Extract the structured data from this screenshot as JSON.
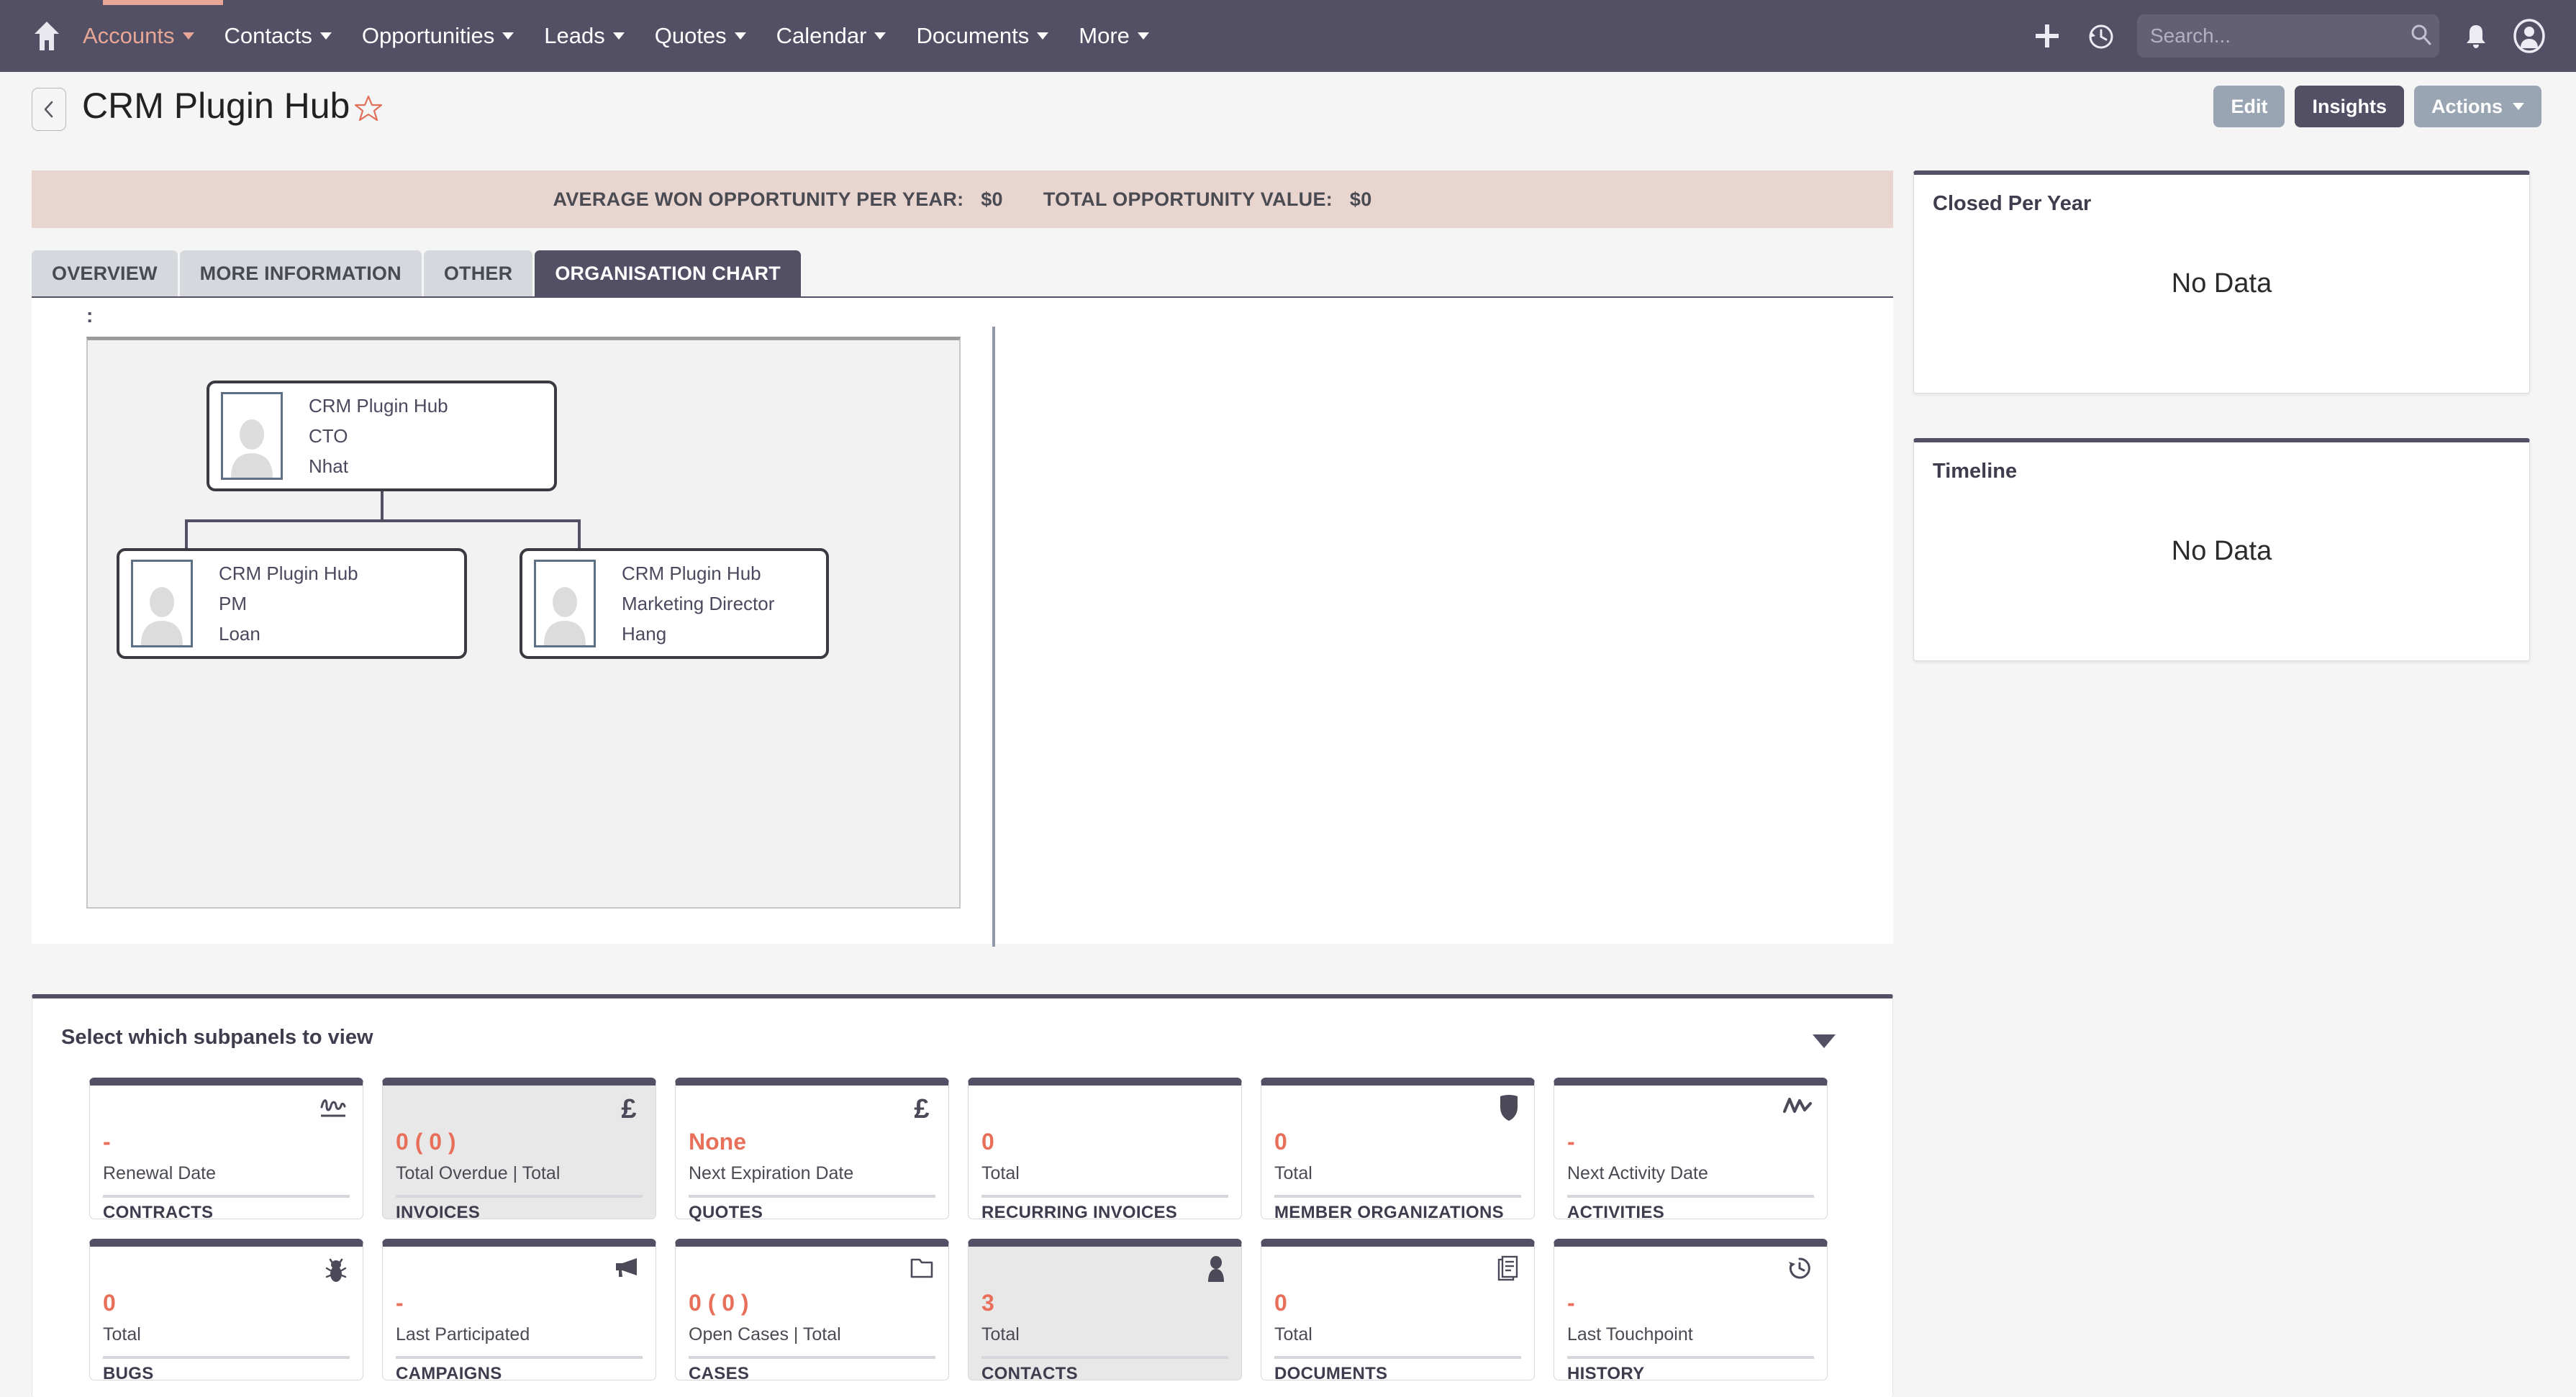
{
  "navbar": {
    "home_icon": "home-icon",
    "items": [
      {
        "label": "Accounts",
        "active": true,
        "caret": true
      },
      {
        "label": "Contacts",
        "active": false,
        "caret": true
      },
      {
        "label": "Opportunities",
        "active": false,
        "caret": true
      },
      {
        "label": "Leads",
        "active": false,
        "caret": true
      },
      {
        "label": "Quotes",
        "active": false,
        "caret": true
      },
      {
        "label": "Calendar",
        "active": false,
        "caret": true
      },
      {
        "label": "Documents",
        "active": false,
        "caret": true
      },
      {
        "label": "More",
        "active": false,
        "caret": true
      }
    ],
    "add_icon": "plus-icon",
    "history_icon": "history-clock-icon",
    "search": {
      "value": "",
      "placeholder": "Search..."
    },
    "search_icon": "search-icon",
    "notifications_icon": "bell-icon",
    "profile_icon": "user-avatar-icon"
  },
  "titlebar": {
    "back_icon": "chevron-left-icon",
    "title": "CRM Plugin Hub",
    "favorite_icon": "star-outline-icon",
    "edit_label": "Edit",
    "insights_label": "Insights",
    "actions_label": "Actions"
  },
  "banner": {
    "avg_label": "AVERAGE WON OPPORTUNITY PER YEAR:",
    "avg_value": "$0",
    "total_label": "TOTAL OPPORTUNITY VALUE:",
    "total_value": "$0"
  },
  "tabs": [
    {
      "label": "OVERVIEW",
      "active": false
    },
    {
      "label": "MORE INFORMATION",
      "active": false
    },
    {
      "label": "OTHER",
      "active": false
    },
    {
      "label": "ORGANISATION CHART",
      "active": true
    }
  ],
  "orgchart": {
    "caption": ":",
    "root": {
      "org": "CRM Plugin Hub",
      "role": "CTO",
      "name": "Nhat"
    },
    "children": [
      {
        "org": "CRM Plugin Hub",
        "role": "PM",
        "name": "Loan"
      },
      {
        "org": "CRM Plugin Hub",
        "role": "Marketing Director",
        "name": "Hang"
      }
    ]
  },
  "side_panels": [
    {
      "title": "Closed Per Year",
      "body": "No Data"
    },
    {
      "title": "Timeline",
      "body": "No Data"
    }
  ],
  "subpanels": {
    "header": "Select which subpanels to view",
    "collapse_icon": "triangle-down-icon",
    "tiles": [
      {
        "value": "-",
        "label": "Renewal Date",
        "name": "CONTRACTS",
        "icon": "signature-icon",
        "selected": false
      },
      {
        "value": "0 ( 0 )",
        "label": "Total Overdue | Total",
        "name": "INVOICES",
        "icon": "pound-currency-icon",
        "selected": true
      },
      {
        "value": "None",
        "label": "Next Expiration Date",
        "name": "QUOTES",
        "icon": "pound-currency-icon",
        "selected": false
      },
      {
        "value": "0",
        "label": "Total",
        "name": "RECURRING INVOICES",
        "icon": "none",
        "selected": false
      },
      {
        "value": "0",
        "label": "Total",
        "name": "MEMBER ORGANIZATIONS",
        "icon": "shield-icon",
        "selected": false
      },
      {
        "value": "-",
        "label": "Next Activity Date",
        "name": "ACTIVITIES",
        "icon": "activity-line-icon",
        "selected": false
      },
      {
        "value": "0",
        "label": "Total",
        "name": "BUGS",
        "icon": "bug-icon",
        "selected": false
      },
      {
        "value": "-",
        "label": "Last Participated",
        "name": "CAMPAIGNS",
        "icon": "megaphone-icon",
        "selected": false
      },
      {
        "value": "0 ( 0 )",
        "label": "Open Cases | Total",
        "name": "CASES",
        "icon": "folder-icon",
        "selected": false
      },
      {
        "value": "3",
        "label": "Total",
        "name": "CONTACTS",
        "icon": "person-icon",
        "selected": true
      },
      {
        "value": "0",
        "label": "Total",
        "name": "DOCUMENTS",
        "icon": "document-icon",
        "selected": false
      },
      {
        "value": "-",
        "label": "Last Touchpoint",
        "name": "HISTORY",
        "icon": "history-clock-icon",
        "selected": false
      }
    ]
  },
  "colors": {
    "navbar": "#534f65",
    "accent_salmon": "#e8a696",
    "banner_bg": "#e9d5cf",
    "value_red": "#e8705a",
    "button_grey": "#9aa5b4"
  }
}
